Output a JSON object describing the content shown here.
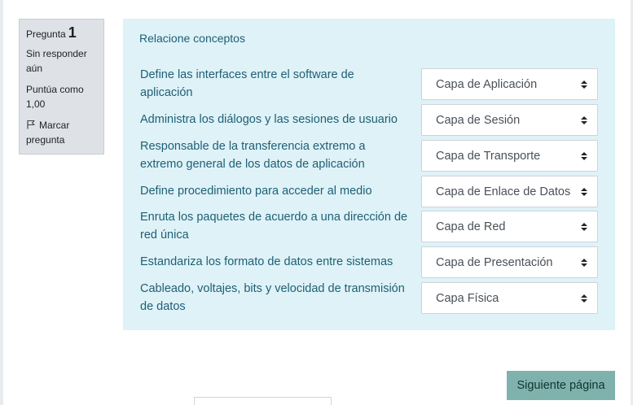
{
  "info": {
    "question_label": "Pregunta",
    "question_number": "1",
    "state": "Sin responder aún",
    "grade": "Puntúa como 1,00",
    "flag_label": "Marcar pregunta"
  },
  "question": {
    "text": "Relacione conceptos",
    "rows": [
      {
        "label": "Define las interfaces entre el software de aplicación",
        "selected": "Capa de Aplicación"
      },
      {
        "label": "Administra los diálogos y las sesiones de usuario",
        "selected": "Capa de Sesión"
      },
      {
        "label": "Responsable de la transferencia extremo a extremo general de los datos de aplicación",
        "selected": "Capa de Transporte"
      },
      {
        "label": "Define procedimiento para acceder al medio",
        "selected": "Capa de Enlace de Datos"
      },
      {
        "label": "Enruta los paquetes de acuerdo a una dirección de red única",
        "selected": "Capa de Red"
      },
      {
        "label": "Estandariza los formato de datos entre sistemas",
        "selected": "Capa de Presentación"
      },
      {
        "label": "Cableado, voltajes, bits y velocidad de transmisión de datos",
        "selected": "Capa Física"
      }
    ]
  },
  "nav": {
    "next_label": "Siguiente página"
  },
  "colors": {
    "question_bg": "#def2f8",
    "info_bg": "#dee2e6",
    "next_button_bg": "#7fb2ad"
  }
}
